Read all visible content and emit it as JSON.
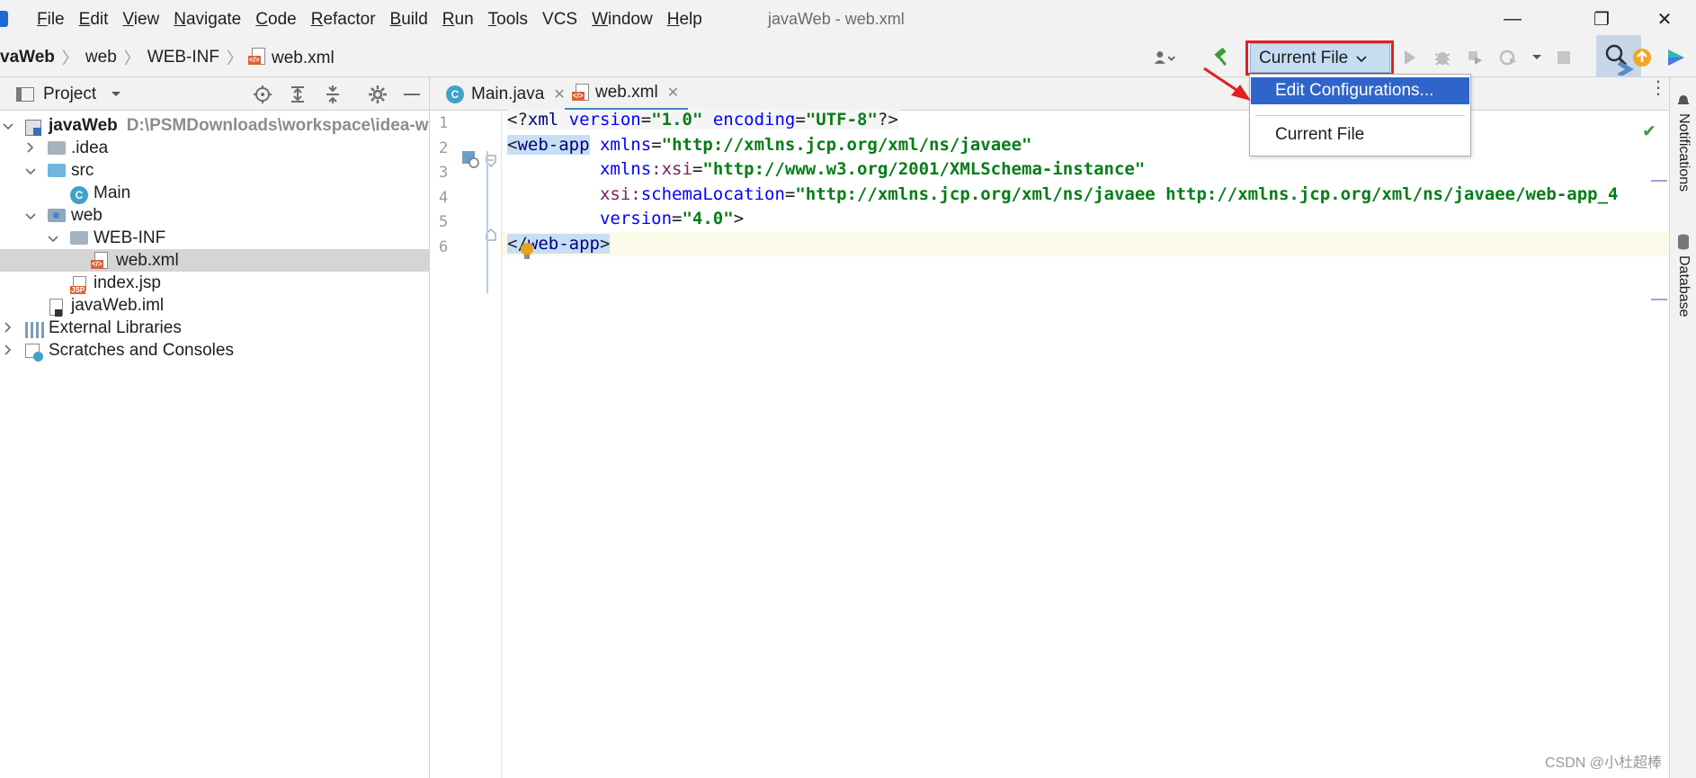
{
  "window": {
    "title": "javaWeb - web.xml",
    "minimize_glyph": "—",
    "restore_glyph": "❐",
    "close_glyph": "✕"
  },
  "menu": {
    "items": [
      {
        "underline": "F",
        "rest": "ile"
      },
      {
        "underline": "E",
        "rest": "dit"
      },
      {
        "underline": "V",
        "rest": "iew"
      },
      {
        "underline": "N",
        "rest": "avigate"
      },
      {
        "underline": "C",
        "rest": "ode"
      },
      {
        "underline": "R",
        "rest": "efactor"
      },
      {
        "underline": "B",
        "rest": "uild"
      },
      {
        "underline": "R",
        "rest": "un"
      },
      {
        "underline": "T",
        "rest": "ools"
      },
      {
        "underline": "",
        "rest": "VCS"
      },
      {
        "underline": "W",
        "rest": "indow"
      },
      {
        "underline": "H",
        "rest": "elp"
      }
    ]
  },
  "breadcrumb": {
    "project": "vaWeb",
    "items": [
      "web",
      "WEB-INF",
      "web.xml"
    ],
    "separator": "〉"
  },
  "run_config": {
    "selected": "Current File",
    "chevron": "⌄"
  },
  "dropdown": {
    "options": [
      "Edit Configurations...",
      "Current File"
    ],
    "highlighted_index": 0
  },
  "project_panel": {
    "title": "Project",
    "tree": [
      {
        "depth": 0,
        "expanded": true,
        "icon": "module-icon",
        "label": "javaWeb",
        "bold": true,
        "path": "D:\\PSMDownloads\\workspace\\idea-wo"
      },
      {
        "depth": 1,
        "expanded": false,
        "icon": "folder-icon",
        "label": ".idea"
      },
      {
        "depth": 1,
        "expanded": true,
        "icon": "source-folder-icon",
        "label": "src"
      },
      {
        "depth": 2,
        "expanded": null,
        "icon": "class-icon",
        "label": "Main"
      },
      {
        "depth": 1,
        "expanded": true,
        "icon": "web-folder-icon",
        "label": "web"
      },
      {
        "depth": 2,
        "expanded": true,
        "icon": "folder-icon",
        "label": "WEB-INF"
      },
      {
        "depth": 3,
        "expanded": null,
        "icon": "xml-file-icon",
        "label": "web.xml",
        "selected": true
      },
      {
        "depth": 2,
        "expanded": null,
        "icon": "jsp-file-icon",
        "label": "index.jsp"
      },
      {
        "depth": 1,
        "expanded": null,
        "icon": "iml-file-icon",
        "label": "javaWeb.iml"
      },
      {
        "depth": 0,
        "expanded": false,
        "icon": "library-icon",
        "label": "External Libraries"
      },
      {
        "depth": 0,
        "expanded": false,
        "icon": "scratches-icon",
        "label": "Scratches and Consoles"
      }
    ]
  },
  "editor": {
    "tabs": [
      {
        "label": "Main.java",
        "active": false,
        "icon": "class-icon"
      },
      {
        "label": "web.xml",
        "active": true,
        "icon": "xml-file-icon"
      }
    ],
    "line_numbers": [
      "1",
      "2",
      "3",
      "4",
      "5",
      "6"
    ],
    "lines": [
      {
        "segments": [
          [
            "c-punct c-pi",
            "<?"
          ],
          [
            "c-tag c-pi",
            "xml "
          ],
          [
            "c-attr c-pi",
            "version"
          ],
          [
            "c-punct c-pi",
            "="
          ],
          [
            "c-val c-pi",
            "\"1.0\""
          ],
          [
            "c-pi",
            " "
          ],
          [
            "c-attr c-pi",
            "encoding"
          ],
          [
            "c-punct c-pi",
            "="
          ],
          [
            "c-val c-pi",
            "\"UTF-8\""
          ],
          [
            "c-punct c-pi",
            "?>"
          ]
        ]
      },
      {
        "segments": [
          [
            "c-punct tag-hl",
            "<"
          ],
          [
            "c-tag tag-hl",
            "web-app"
          ],
          [
            "",
            " "
          ],
          [
            "c-attr",
            "xmlns"
          ],
          [
            "c-punct",
            "="
          ],
          [
            "c-val",
            "\"http://xmlns.jcp.org/xml/ns/javaee\""
          ]
        ]
      },
      {
        "segments": [
          [
            "",
            "         "
          ],
          [
            "c-attr",
            "xmlns"
          ],
          [
            "c-ns",
            ":"
          ],
          [
            "c-ns",
            "xsi"
          ],
          [
            "c-punct",
            "="
          ],
          [
            "c-val",
            "\"http://www.w3.org/2001/XMLSchema-instance\""
          ]
        ]
      },
      {
        "segments": [
          [
            "",
            "         "
          ],
          [
            "c-ns",
            "xsi"
          ],
          [
            "c-ns",
            ":"
          ],
          [
            "c-attr",
            "schemaLocation"
          ],
          [
            "c-punct",
            "="
          ],
          [
            "c-val",
            "\"http://xmlns.jcp.org/xml/ns/javaee http://xmlns.jcp.org/xml/ns/javaee/web-app_4"
          ]
        ]
      },
      {
        "segments": [
          [
            "",
            "         "
          ],
          [
            "c-attr",
            "version"
          ],
          [
            "c-punct",
            "="
          ],
          [
            "c-val",
            "\"4.0\""
          ],
          [
            "c-punct",
            ">"
          ]
        ]
      },
      {
        "segments": [
          [
            "c-punct tag-hl",
            "</"
          ],
          [
            "c-tag tag-hl",
            "web-app"
          ],
          [
            "c-punct tag-hl",
            ">"
          ]
        ]
      }
    ],
    "current_line": 6
  },
  "right_strip": {
    "notifications": "Notifications",
    "database": "Database"
  },
  "watermark": "CSDN @小杜超棒"
}
